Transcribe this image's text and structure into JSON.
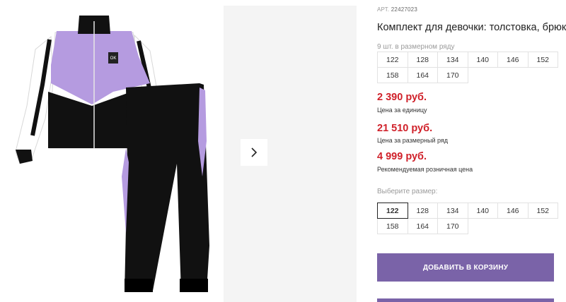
{
  "gallery": {
    "main_image_name": "girls-tracksuit-photo",
    "next_icon": "chevron-right-icon"
  },
  "product": {
    "article_prefix": "АРТ.",
    "article_number": "22427023",
    "title": "Комплект для девочки: толстовка, брюки",
    "row_note": "9 шт. в размерном ряду",
    "size_row": [
      "122",
      "128",
      "134",
      "140",
      "146",
      "152",
      "158",
      "164",
      "170"
    ],
    "price_unit": "2 390 руб.",
    "price_unit_label": "Цена за единицу",
    "price_row": "21 510 руб.",
    "price_row_label": "Цена за размерный ряд",
    "price_retail": "4 999 руб.",
    "price_retail_label": "Рекомендуемая розничная цена",
    "choose_label": "Выберите размер:",
    "choose_sizes": [
      "122",
      "128",
      "134",
      "140",
      "146",
      "152",
      "158",
      "164",
      "170"
    ],
    "selected_size": "122",
    "add_to_cart": "ДОБАВИТЬ В КОРЗИНУ"
  },
  "colors": {
    "price": "#d0212a",
    "button": "#7a63a8",
    "lavender": "#b59be0"
  }
}
